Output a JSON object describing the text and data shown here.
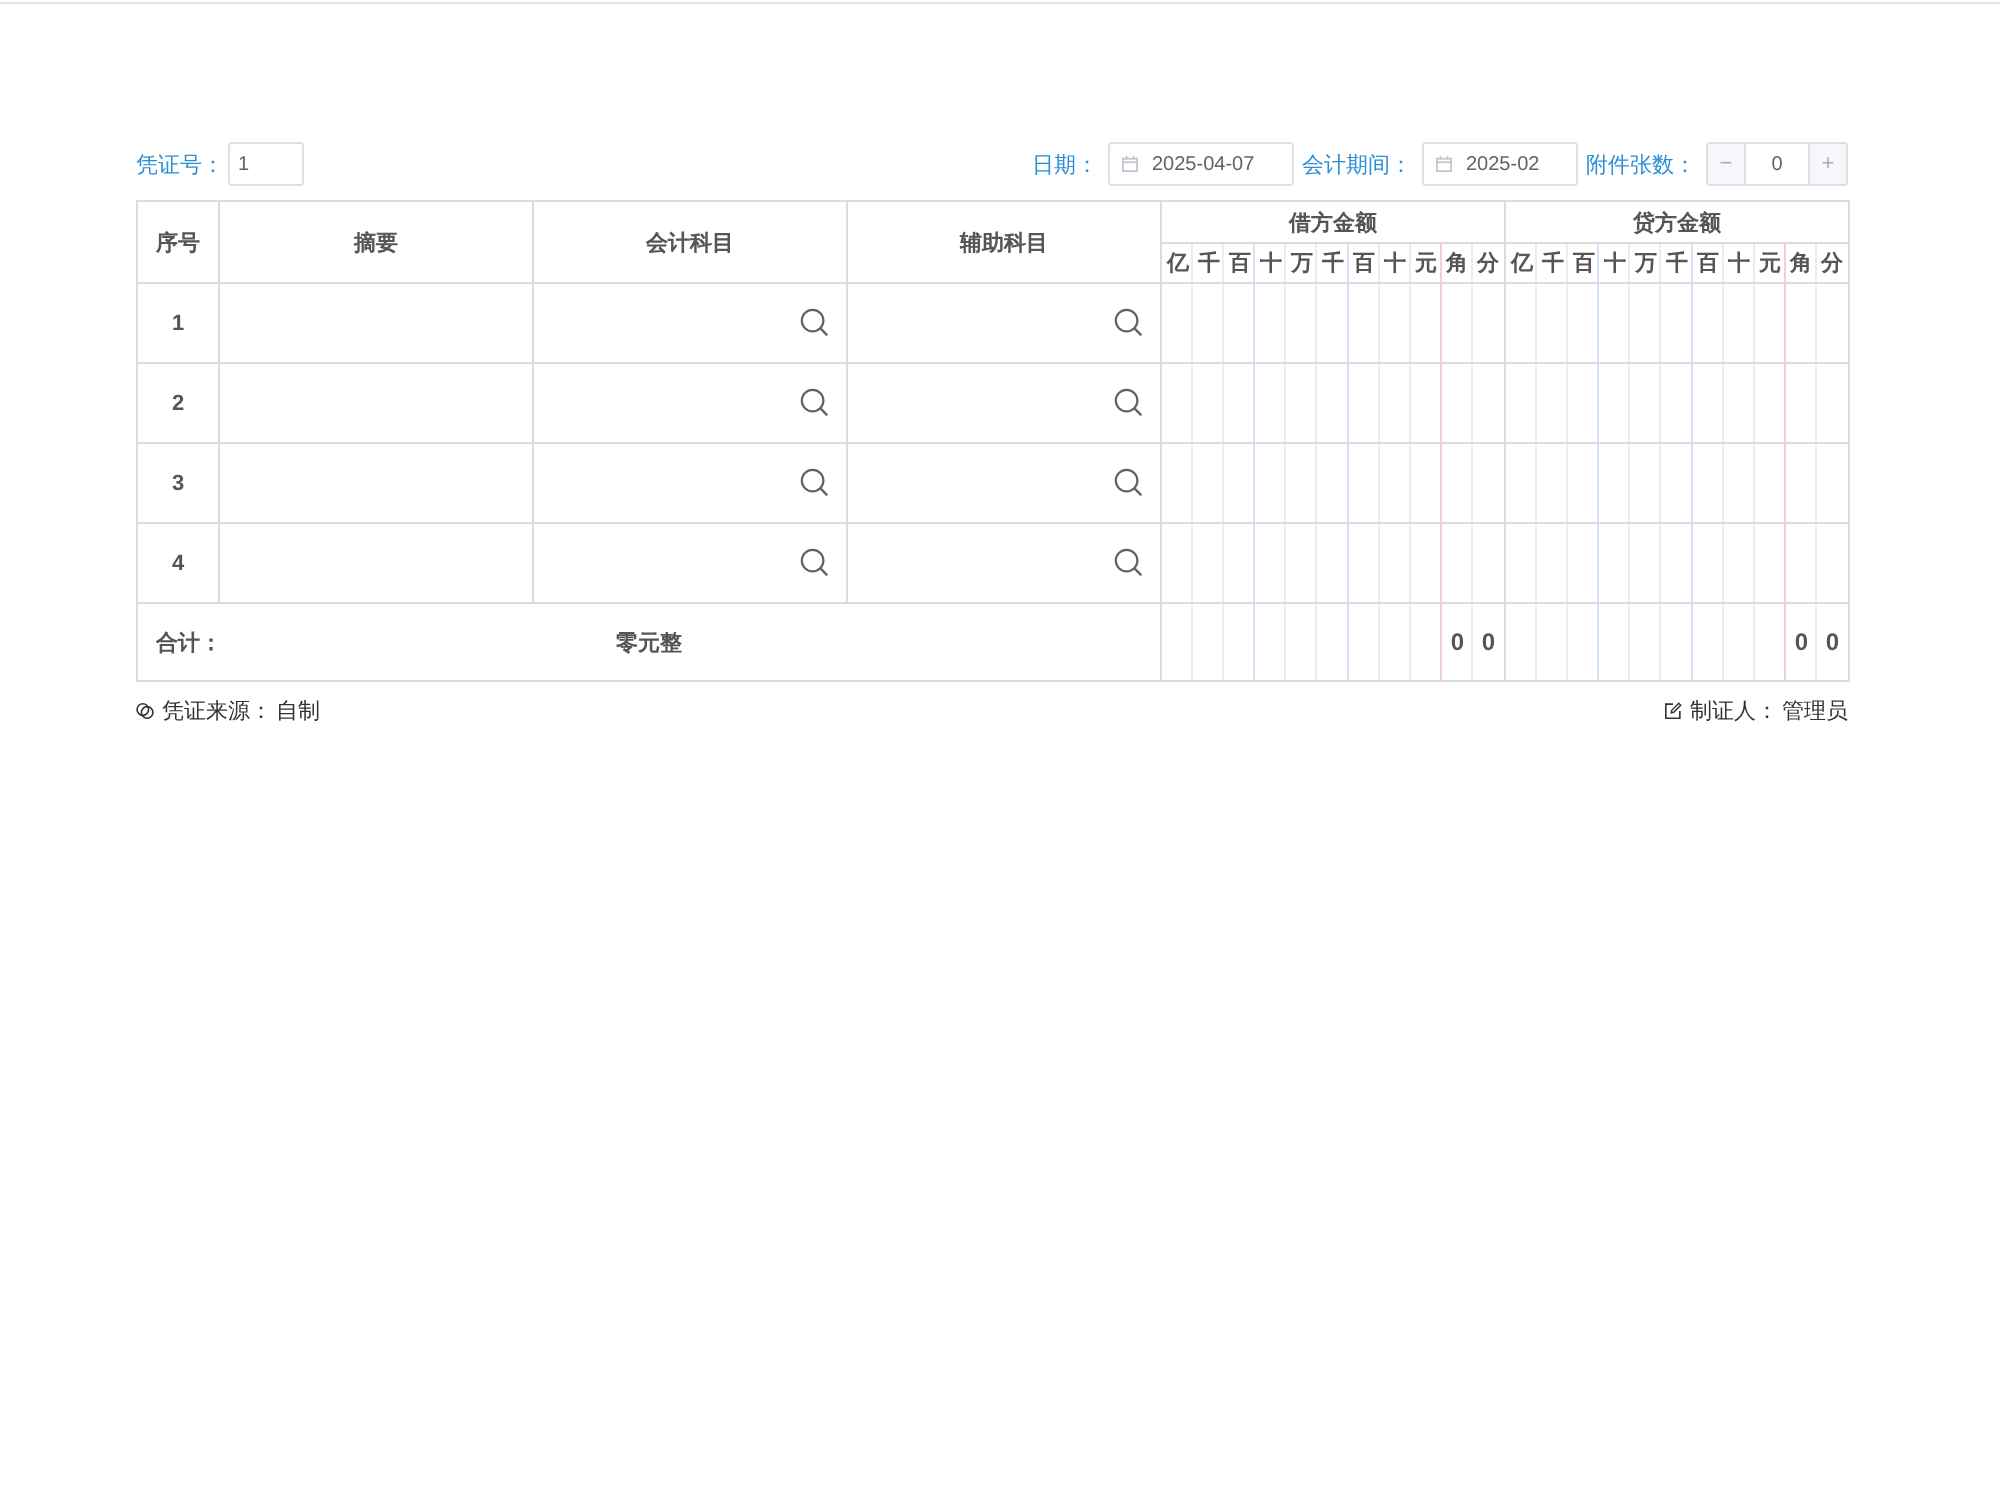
{
  "header": {
    "voucher_no": {
      "label": "凭证号：",
      "value": "1"
    },
    "date": {
      "label": "日期：",
      "value": "2025-04-07"
    },
    "period": {
      "label": "会计期间：",
      "value": "2025-02"
    },
    "attachments": {
      "label": "附件张数：",
      "minus": "−",
      "value": "0",
      "plus": "+"
    }
  },
  "table": {
    "columns": [
      {
        "label": "序号",
        "kind": "index"
      },
      {
        "label": "摘要",
        "kind": "text"
      },
      {
        "label": "会计科目",
        "kind": "lookup"
      },
      {
        "label": "辅助科目",
        "kind": "lookup"
      }
    ],
    "amount_groups": [
      {
        "label": "借方金额",
        "digits": [
          "亿",
          "千",
          "百",
          "十",
          "万",
          "千",
          "百",
          "十",
          "元",
          "角",
          "分"
        ]
      },
      {
        "label": "贷方金额",
        "digits": [
          "亿",
          "千",
          "百",
          "十",
          "万",
          "千",
          "百",
          "十",
          "元",
          "角",
          "分"
        ]
      }
    ],
    "rows": [
      {
        "no": "1"
      },
      {
        "no": "2"
      },
      {
        "no": "3"
      },
      {
        "no": "4"
      }
    ],
    "total": {
      "label": "合计：",
      "words": "零元整",
      "amounts": [
        [
          "0",
          "0"
        ],
        [
          "0",
          "0"
        ]
      ]
    }
  },
  "footer": {
    "source": {
      "label": "凭证来源：",
      "value": "自制"
    },
    "maker": {
      "label": "制证人：",
      "value": "管理员"
    }
  }
}
